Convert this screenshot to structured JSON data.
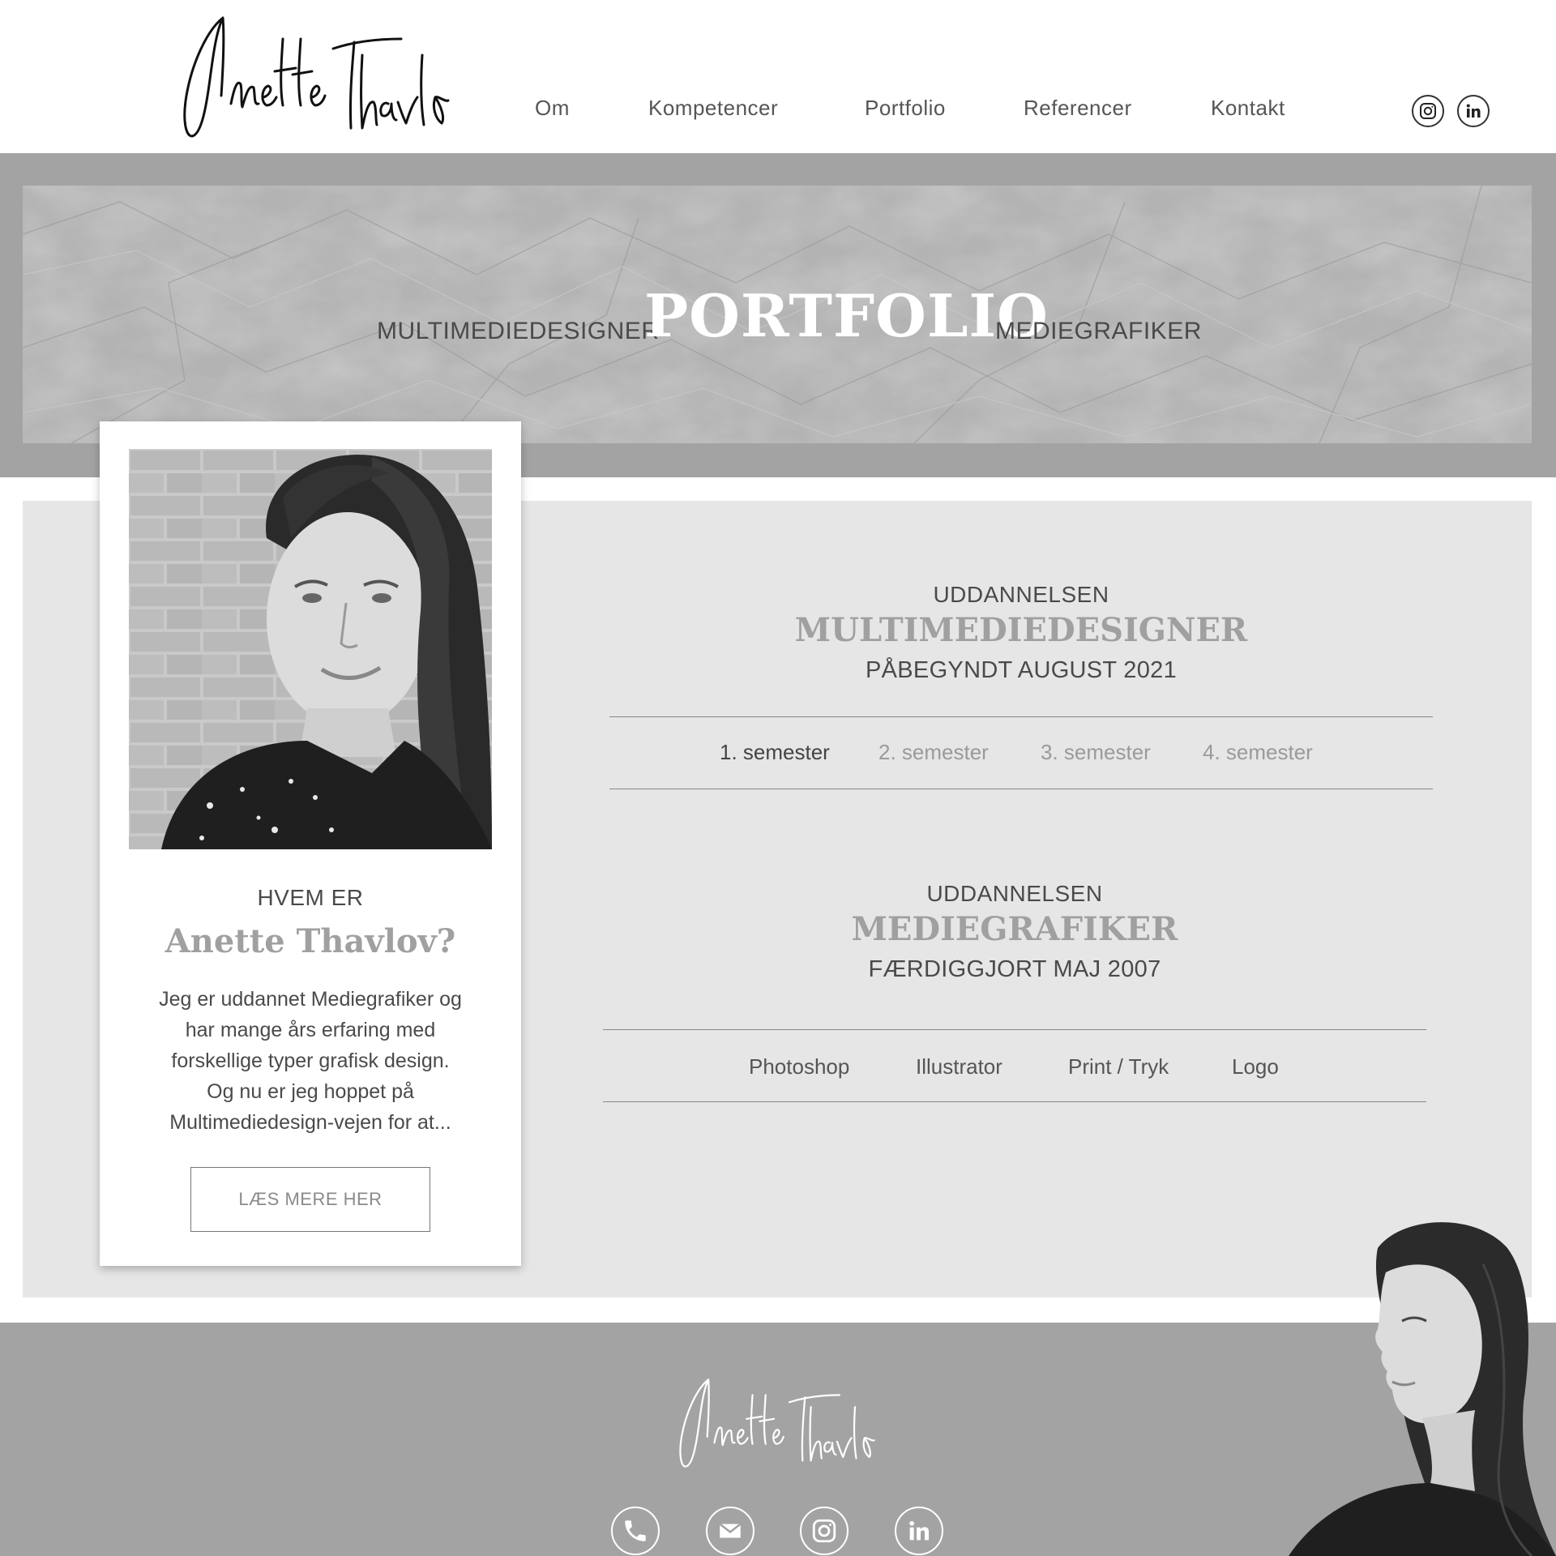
{
  "header": {
    "logo_signature": "Anette Thavlov",
    "nav": [
      "Om",
      "Kompetencer",
      "Portfolio",
      "Referencer",
      "Kontakt"
    ],
    "social": [
      "instagram-icon",
      "linkedin-icon"
    ]
  },
  "banner": {
    "left": "MULTIMEDIEDESIGNER",
    "title": "PORTFOLIO",
    "right": "MEDIEGRAFIKER"
  },
  "profile": {
    "pre": "HVEM ER",
    "name": "Anette Thavlov?",
    "text_lines": [
      "Jeg er uddannet Mediegrafiker og",
      "har mange års erfaring med",
      "forskellige typer grafisk design.",
      "Og nu er jeg hoppet på",
      "Multimediedesign-vejen for at..."
    ],
    "button": "LÆS MERE HER"
  },
  "education": [
    {
      "pre": "UDDANNELSEN",
      "title": "MULTIMEDIEDESIGNER",
      "date": "PÅBEGYNDT AUGUST 2021",
      "tabs": [
        "1. semester",
        "2. semester",
        "3. semester",
        "4. semester"
      ],
      "active_tab": "1. semester"
    },
    {
      "pre": "UDDANNELSEN",
      "title": "MEDIEGRAFIKER",
      "date": "FÆRDIGGJORT MAJ 2007",
      "tabs": [
        "Photoshop",
        "Illustrator",
        "Print / Tryk",
        "Logo"
      ]
    }
  ],
  "footer": {
    "logo_signature": "Anette Thavlov",
    "icons": [
      "phone-icon",
      "mail-icon",
      "instagram-icon",
      "linkedin-icon"
    ]
  },
  "colors": {
    "band_gray": "#a3a3a3",
    "content_gray": "#e6e6e6",
    "accent_gray": "#a0a0a0",
    "text_dark": "#4a4a4a"
  }
}
